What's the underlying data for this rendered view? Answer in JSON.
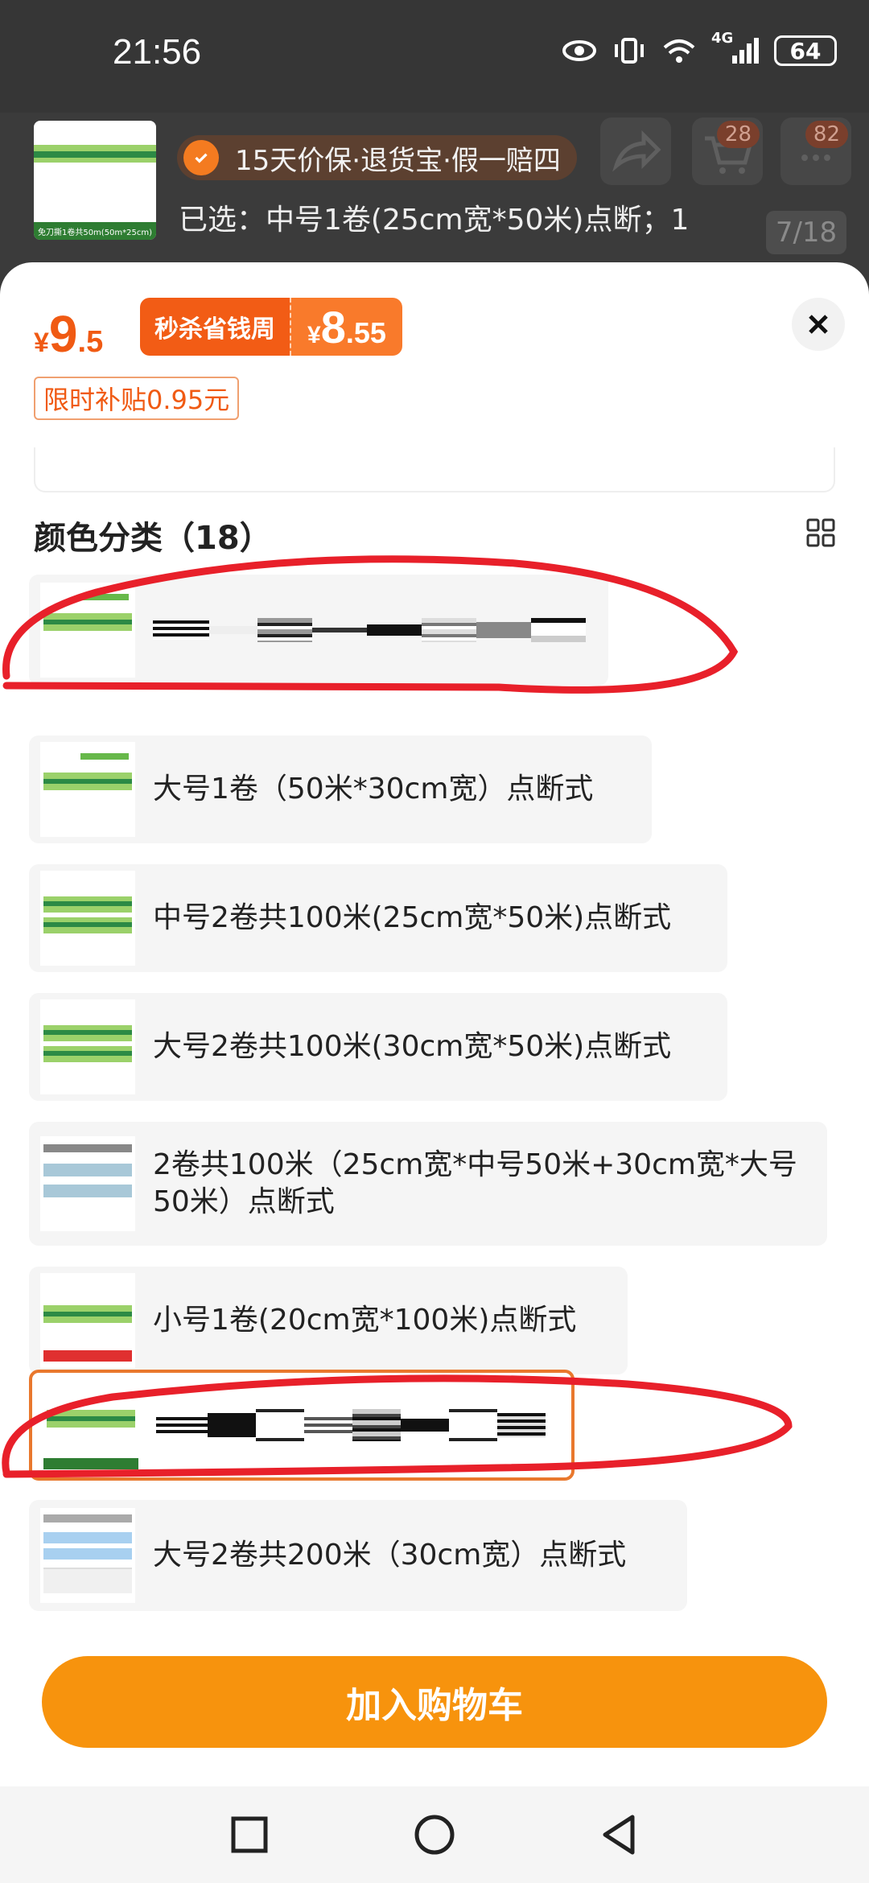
{
  "status_bar": {
    "time": "21:56",
    "network": "4G",
    "battery": "64"
  },
  "header": {
    "thumb_caption": "免刀撕1卷共50m(50m*25cm)",
    "service_text": "15天价保·退货宝·假一赔四",
    "selected_text": "已选：中号1卷(25cm宽*50米)点断；1",
    "cart_badge": "28",
    "message_badge": "82",
    "page_indicator": "7/18"
  },
  "price": {
    "currency": "¥",
    "original_int": "9",
    "original_dec": ".5",
    "promo_label": "秒杀省钱周",
    "promo_int": "8",
    "promo_dec": ".55",
    "subsidy": "限时补贴0.95元"
  },
  "section": {
    "title": "颜色分类（18）"
  },
  "options": [
    {
      "label": "",
      "redacted": true
    },
    {
      "label": "大号1卷（50米*30cm宽）点断式"
    },
    {
      "label": "中号2卷共100米(25cm宽*50米)点断式"
    },
    {
      "label": "大号2卷共100米(30cm宽*50米)点断式"
    },
    {
      "label": "2卷共100米（25cm宽*中号50米+30cm宽*大号50米）点断式"
    },
    {
      "label": "小号1卷(20cm宽*100米)点断式"
    },
    {
      "label": "",
      "redacted": true,
      "selected": true
    },
    {
      "label": "大号2卷共200米（30cm宽）点断式"
    }
  ],
  "footer": {
    "add_to_cart": "加入购物车"
  },
  "colors": {
    "accent": "#f05a13",
    "button": "#f7930d",
    "scribble": "#e8202a"
  }
}
